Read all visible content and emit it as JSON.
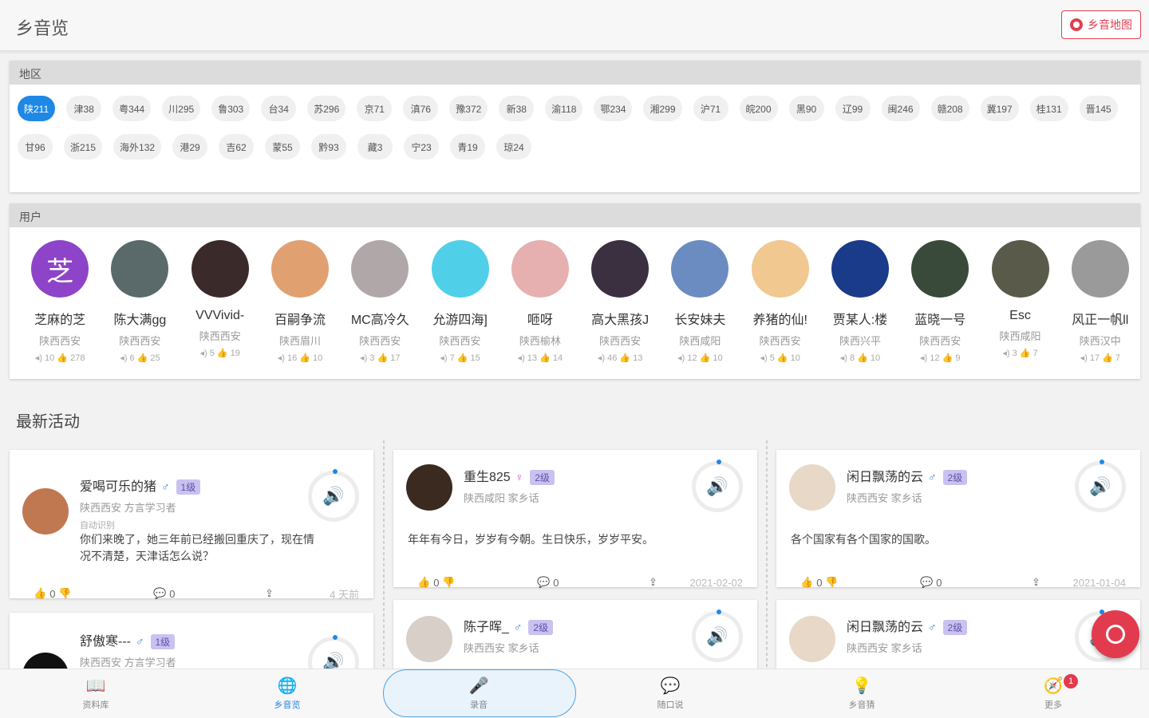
{
  "app_title": "乡音览",
  "map_button_label": "乡音地图",
  "accent_color": "#1e88e5",
  "brand_red": "#e23b4e",
  "regions": {
    "header": "地区",
    "chips": [
      "陕211",
      "津38",
      "粤344",
      "川295",
      "鲁303",
      "台34",
      "苏296",
      "京71",
      "滇76",
      "豫372",
      "新38",
      "渝118",
      "鄂234",
      "湘299",
      "沪71",
      "皖200",
      "黑90",
      "辽99",
      "闽246",
      "赣208",
      "冀197",
      "桂131",
      "晋145",
      "甘96",
      "浙215",
      "海外132",
      "港29",
      "吉62",
      "蒙55",
      "黔93",
      "藏3",
      "宁23",
      "青19",
      "琼24"
    ],
    "selected": "陕211"
  },
  "users": {
    "header": "用户",
    "list": [
      {
        "name": "芝麻的芝",
        "loc": "陕西西安",
        "plays": "10",
        "likes": "278",
        "avatar_char": "芝",
        "avatar_color": "#8e44c8"
      },
      {
        "name": "陈大满gg",
        "loc": "陕西西安",
        "plays": "6",
        "likes": "25",
        "avatar_char": "",
        "avatar_color": "#5a6a6a"
      },
      {
        "name": "VVVivid-",
        "loc": "陕西西安",
        "plays": "5",
        "likes": "19",
        "avatar_char": "",
        "avatar_color": "#3b2a2a"
      },
      {
        "name": "百嗣争流",
        "loc": "陕西眉川",
        "plays": "16",
        "likes": "10",
        "avatar_char": "",
        "avatar_color": "#e0a070"
      },
      {
        "name": "MC高冷久",
        "loc": "陕西西安",
        "plays": "3",
        "likes": "17",
        "avatar_char": "",
        "avatar_color": "#b0a8a8"
      },
      {
        "name": "允游四海]",
        "loc": "陕西西安",
        "plays": "7",
        "likes": "15",
        "avatar_char": "",
        "avatar_color": "#4fd0e8"
      },
      {
        "name": "咂呀",
        "loc": "陕西榆林",
        "plays": "13",
        "likes": "14",
        "avatar_char": "",
        "avatar_color": "#e6b0b0"
      },
      {
        "name": "高大黑孩J",
        "loc": "陕西西安",
        "plays": "46",
        "likes": "13",
        "avatar_char": "",
        "avatar_color": "#3a3040"
      },
      {
        "name": "长安妹夫",
        "loc": "陕西咸阳",
        "plays": "12",
        "likes": "10",
        "avatar_char": "",
        "avatar_color": "#6a8cc0"
      },
      {
        "name": "养猪的仙!",
        "loc": "陕西西安",
        "plays": "5",
        "likes": "10",
        "avatar_char": "",
        "avatar_color": "#f0c890"
      },
      {
        "name": "贾某人:楼",
        "loc": "陕西兴平",
        "plays": "8",
        "likes": "10",
        "avatar_char": "",
        "avatar_color": "#1a3a8a"
      },
      {
        "name": "蓝晓一号",
        "loc": "陕西西安",
        "plays": "12",
        "likes": "9",
        "avatar_char": "",
        "avatar_color": "#3a4a3a"
      },
      {
        "name": "Esc",
        "loc": "陕西咸阳",
        "plays": "3",
        "likes": "7",
        "avatar_char": "",
        "avatar_color": "#5a5a4a"
      },
      {
        "name": "风正一帆ll",
        "loc": "陕西汉中",
        "plays": "17",
        "likes": "7",
        "avatar_char": "",
        "avatar_color": "#9a9a9a"
      }
    ]
  },
  "activity": {
    "title": "最新活动",
    "cards": [
      {
        "name": "爱喝可乐的猪",
        "gender": "♂",
        "gender_kind": "male",
        "level": "1级",
        "sub": "陕西西安 方言学习者",
        "tag": "自动识别",
        "text": "你们来晚了，她三年前已经搬回重庆了，现在情况不清楚，天津话怎么说？",
        "likes": "0",
        "comments": "0",
        "time": "4 天前",
        "avatar_color": "#c07850"
      },
      {
        "name": "重生825",
        "gender": "♀",
        "gender_kind": "female",
        "level": "2级",
        "sub": "陕西咸阳 家乡话",
        "tag": "",
        "text": "年年有今日，岁岁有今朝。生日快乐，岁岁平安。",
        "likes": "0",
        "comments": "0",
        "time": "2021-02-02",
        "avatar_color": "#3a2a20"
      },
      {
        "name": "闲日飘荡的云",
        "gender": "♂",
        "gender_kind": "male",
        "level": "2级",
        "sub": "陕西西安 家乡话",
        "tag": "",
        "text": "各个国家有各个国家的国歌。",
        "likes": "0",
        "comments": "0",
        "time": "2021-01-04",
        "avatar_color": "#e8d8c8"
      },
      {
        "name": "舒傲寒---",
        "gender": "♂",
        "gender_kind": "male",
        "level": "1级",
        "sub": "陕西西安 方言学习者",
        "tag": "",
        "text": "",
        "avatar_color": "#111111"
      },
      {
        "name": "陈子晖_",
        "gender": "♂",
        "gender_kind": "male",
        "level": "2级",
        "sub": "陕西西安 家乡话",
        "tag": "",
        "text": "",
        "avatar_color": "#d8d0c8"
      },
      {
        "name": "闲日飘荡的云",
        "gender": "♂",
        "gender_kind": "male",
        "level": "2级",
        "sub": "陕西西安 家乡话",
        "tag": "",
        "text": "",
        "avatar_color": "#e8d8c8"
      }
    ]
  },
  "bottom_nav": {
    "items": [
      {
        "label": "资料库",
        "icon": "book-icon"
      },
      {
        "label": "乡音览",
        "icon": "globe-icon"
      },
      {
        "label": "录音",
        "icon": "mic-icon"
      },
      {
        "label": "随口说",
        "icon": "chat-icon"
      },
      {
        "label": "乡音猜",
        "icon": "lightbulb-icon"
      },
      {
        "label": "更多",
        "icon": "compass-icon"
      }
    ],
    "active": "乡音览",
    "more_badge": "1"
  }
}
